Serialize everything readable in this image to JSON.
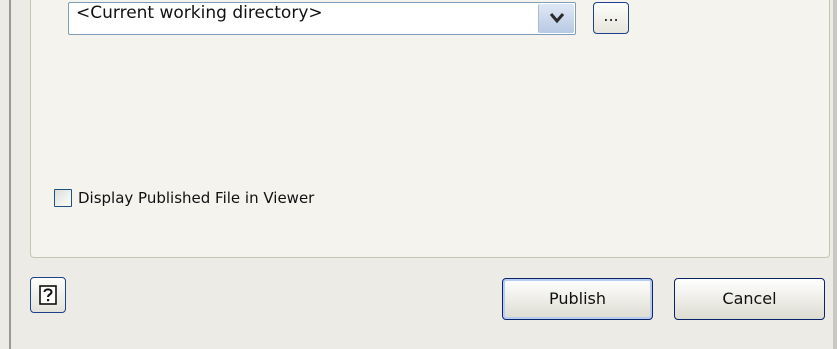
{
  "output_location": {
    "value": "<Current working directory>",
    "browse_label": "..."
  },
  "options": {
    "display_in_viewer_label": "Display Published File in Viewer",
    "display_in_viewer_checked": false
  },
  "footer": {
    "publish_label": "Publish",
    "cancel_label": "Cancel"
  },
  "icons": {
    "combo_arrow": "chevron-down-icon",
    "help": "help-icon"
  }
}
